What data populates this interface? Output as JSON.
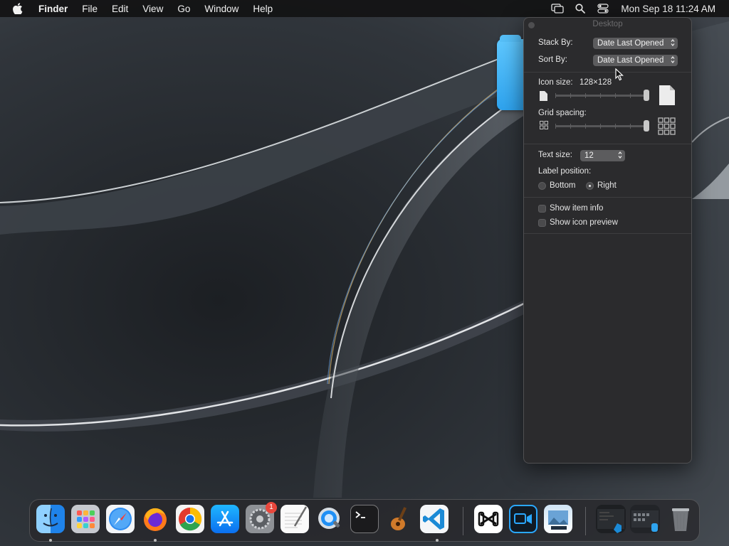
{
  "menubar": {
    "app_name": "Finder",
    "menus": [
      "File",
      "Edit",
      "View",
      "Go",
      "Window",
      "Help"
    ],
    "clock": "Mon Sep 18  11:24 AM",
    "status_icons": [
      "screen-mirroring-icon",
      "spotlight-search-icon",
      "control-center-icon"
    ]
  },
  "panel": {
    "title": "Desktop",
    "stack_by_label": "Stack By:",
    "stack_by_value": "Date Last Opened",
    "sort_by_label": "Sort By:",
    "sort_by_value": "Date Last Opened",
    "icon_size_label": "Icon size:",
    "icon_size_value": "128×128",
    "icon_size_level": 1.0,
    "grid_spacing_label": "Grid spacing:",
    "grid_spacing_level": 1.0,
    "text_size_label": "Text size:",
    "text_size_value": "12",
    "label_position_label": "Label position:",
    "label_position_options": [
      "Bottom",
      "Right"
    ],
    "label_position_selected": "Right",
    "show_item_info_label": "Show item info",
    "show_item_info_checked": false,
    "show_icon_preview_label": "Show icon preview",
    "show_icon_preview_checked": false
  },
  "dock": {
    "apps": [
      {
        "name": "Finder",
        "icon": "finder-icon",
        "running": true
      },
      {
        "name": "Launchpad",
        "icon": "launchpad-icon",
        "running": false
      },
      {
        "name": "Safari",
        "icon": "safari-icon",
        "running": false
      },
      {
        "name": "Firefox",
        "icon": "firefox-icon",
        "running": true
      },
      {
        "name": "Chrome",
        "icon": "chrome-icon",
        "running": false
      },
      {
        "name": "App Store",
        "icon": "app-store-icon",
        "running": false
      },
      {
        "name": "System Settings",
        "icon": "system-settings-icon",
        "running": false,
        "badge": "1"
      },
      {
        "name": "TextEdit",
        "icon": "textedit-icon",
        "running": false
      },
      {
        "name": "QuickTime Player",
        "icon": "quicktime-icon",
        "running": false
      },
      {
        "name": "Terminal",
        "icon": "terminal-icon",
        "running": false
      },
      {
        "name": "GarageBand",
        "icon": "garageband-icon",
        "running": false
      },
      {
        "name": "Visual Studio Code",
        "icon": "vscode-icon",
        "running": true
      },
      {
        "name": "CapCut",
        "icon": "capcut-icon",
        "running": false
      },
      {
        "name": "Screen Recorder",
        "icon": "screen-recorder-icon",
        "running": false
      },
      {
        "name": "Preview",
        "icon": "preview-icon",
        "running": false
      },
      {
        "name": "Recent Window 1",
        "icon": "window-thumbnail-icon",
        "running": false
      },
      {
        "name": "Recent Window 2",
        "icon": "window-thumbnail-icon",
        "running": false
      },
      {
        "name": "Trash",
        "icon": "trash-icon",
        "running": false
      }
    ]
  },
  "colors": {
    "panel_bg": "#2b2b2d",
    "menubar_bg": "#121214",
    "folder_blue": "#2ea3ee",
    "badge_red": "#e8473c"
  }
}
